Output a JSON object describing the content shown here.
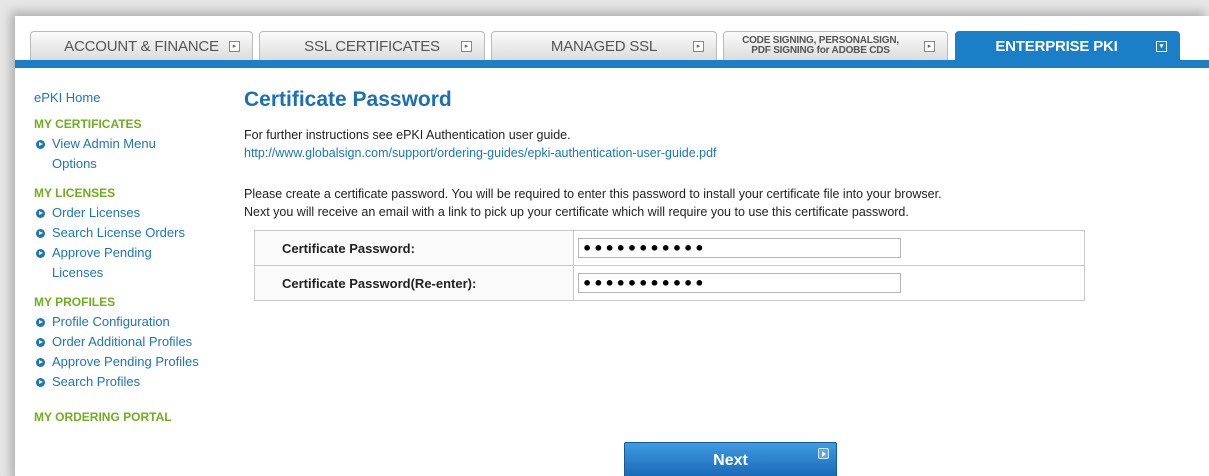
{
  "tabs": [
    {
      "label": "ACCOUNT & FINANCE"
    },
    {
      "label": "SSL CERTIFICATES"
    },
    {
      "label": "MANAGED SSL"
    },
    {
      "label_line1": "CODE SIGNING, PERSONALSIGN,",
      "label_line2": "PDF SIGNING for ADOBE CDS"
    },
    {
      "label": "ENTERPRISE PKI"
    }
  ],
  "sidebar": {
    "home": "ePKI Home",
    "sections": [
      {
        "heading": "MY CERTIFICATES",
        "items": [
          "View Admin Menu Options"
        ]
      },
      {
        "heading": "MY LICENSES",
        "items": [
          "Order Licenses",
          "Search License Orders",
          "Approve Pending Licenses"
        ]
      },
      {
        "heading": "MY PROFILES",
        "items": [
          "Profile Configuration",
          "Order Additional Profiles",
          "Approve Pending Profiles",
          "Search Profiles"
        ]
      },
      {
        "heading": "MY ORDERING PORTAL",
        "items": []
      }
    ]
  },
  "main": {
    "title": "Certificate Password",
    "instructions": "For further instructions see ePKI Authentication user guide.",
    "guide_link": "http://www.globalsign.com/support/ordering-guides/epki-authentication-user-guide.pdf",
    "para_line1": "Please create a certificate password. You will be required to enter this password to install your certificate file into your browser.",
    "para_line2": "Next you will receive an email with a link to pick up your certificate which will require you to use this certificate password.",
    "fields": [
      {
        "label": "Certificate Password:",
        "value": "•••••••••••"
      },
      {
        "label": "Certificate Password(Re-enter):",
        "value": "•••••••••••"
      }
    ],
    "next_label": "Next"
  }
}
